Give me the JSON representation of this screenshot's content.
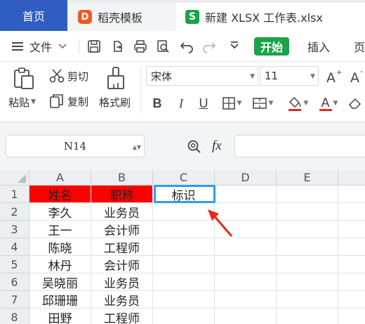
{
  "tabs": {
    "home": "首页",
    "templates": "稻壳模板",
    "file": "新建 XLSX 工作表.xlsx"
  },
  "menu": {
    "file_menu": "文件",
    "start": "开始",
    "insert": "插入",
    "page": "页"
  },
  "ribbon": {
    "paste": "粘贴",
    "cut": "剪切",
    "copy": "复制",
    "format_painter": "格式刷",
    "font_name": "宋体",
    "font_size": "11",
    "bold": "B",
    "italic": "I",
    "underline": "U",
    "font_color": "A"
  },
  "formula_bar": {
    "name_box": "N14",
    "fx": "fx"
  },
  "sheet": {
    "columns": [
      "A",
      "B",
      "C",
      "D",
      "E"
    ],
    "rows": [
      "1",
      "2",
      "3",
      "4",
      "5",
      "6",
      "7",
      "8"
    ],
    "header_row": [
      "姓名",
      "职称",
      "标识"
    ],
    "data": [
      [
        "李久",
        "业务员"
      ],
      [
        "王一",
        "会计师"
      ],
      [
        "陈晓",
        "工程师"
      ],
      [
        "林丹",
        "会计师"
      ],
      [
        "吴晓丽",
        "业务员"
      ],
      [
        "邱珊珊",
        "业务员"
      ],
      [
        "田野",
        "工程师"
      ]
    ],
    "header_fill": "#fe0000",
    "selection_color": "#2e9cf0",
    "arrow_color": "#e8281e"
  }
}
